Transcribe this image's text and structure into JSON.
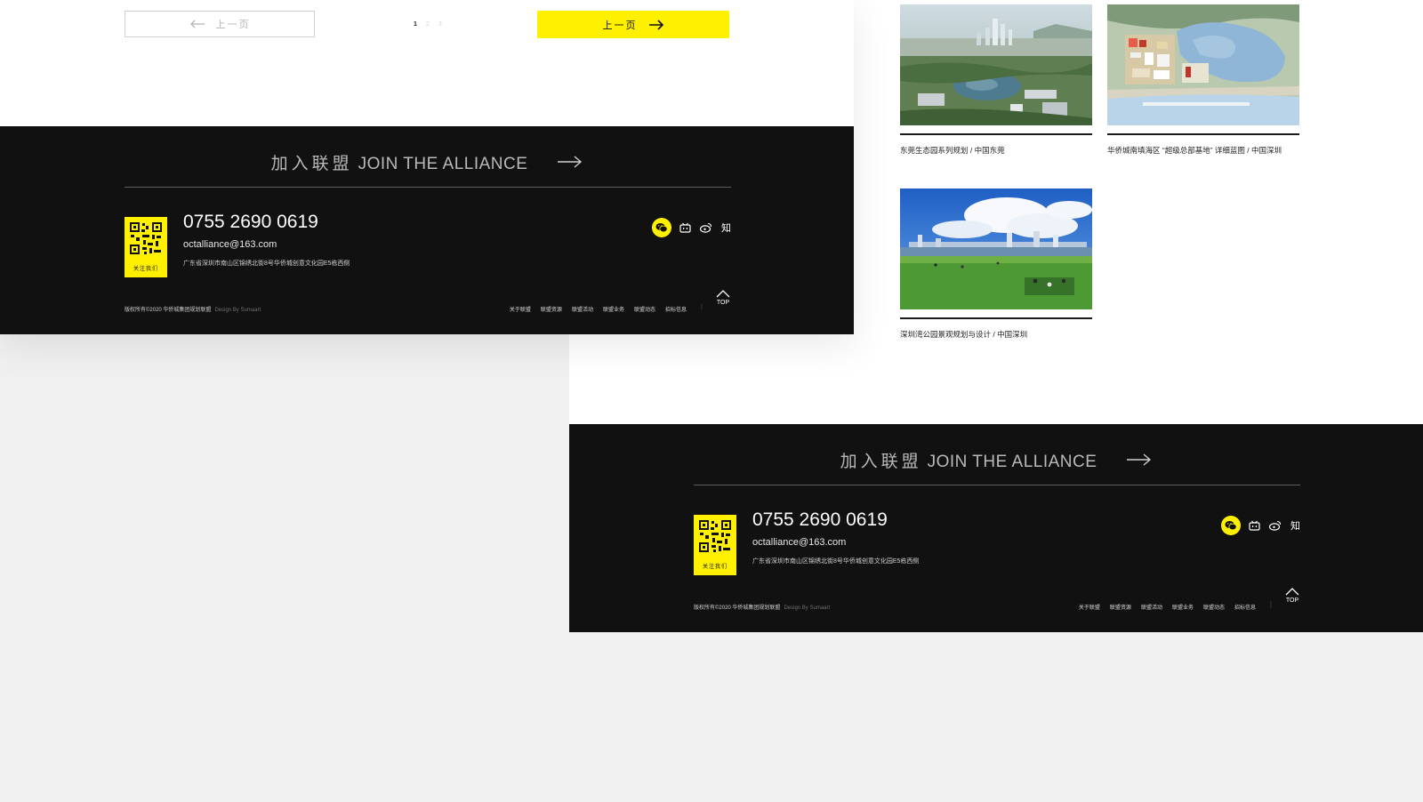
{
  "pagination": {
    "prev_label": "上一页",
    "pages": [
      "1",
      "2",
      "3"
    ],
    "current_page": 1,
    "next_label": "上一页"
  },
  "footer": {
    "join_cn": "加入联盟",
    "join_en": "JOIN THE ALLIANCE",
    "qr_label": "关注我们",
    "phone": "0755 2690 0619",
    "email": "octalliance@163.com",
    "address": "广东省深圳市南山区锦绣北街8号华侨城创意文化园E5栋西侧",
    "copyright": "版权所有©2020 华侨城集团规划联盟",
    "design_by": "Design By Sumaart",
    "nav": [
      "关于联盟",
      "联盟资源",
      "联盟活动",
      "联盟业务",
      "联盟动态",
      "招标信息"
    ],
    "separator": "|",
    "top_label": "TOP",
    "social_icons": [
      "wechat-icon",
      "bilibili-icon",
      "weibo-icon",
      "zhihu-icon"
    ],
    "zhihu_glyph": "知"
  },
  "projects": [
    {
      "caption": "东莞生态园系列规划 / 中国东莞",
      "image": "aerial-city-lake"
    },
    {
      "caption": "华侨城南填海区 “超级总部基地” 详细蓝图 / 中国深圳",
      "image": "master-plan-map"
    },
    {
      "caption": "深圳湾公园景观规划与设计 / 中国深圳",
      "image": "park-lawn-skyline"
    }
  ],
  "colors": {
    "accent": "#fff000",
    "footer_bg": "#111111",
    "page_bg": "#f0f0f0"
  }
}
